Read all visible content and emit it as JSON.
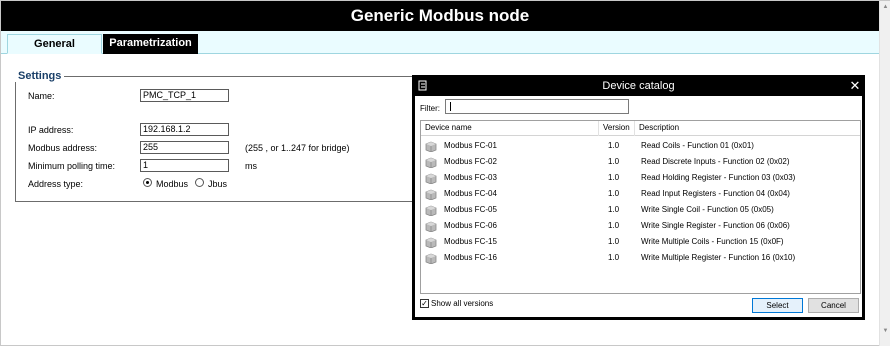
{
  "window": {
    "title": "Generic Modbus node"
  },
  "tabs": [
    {
      "label": "General"
    },
    {
      "label": "Parametrization"
    }
  ],
  "settings": {
    "legend": "Settings",
    "name_label": "Name:",
    "name_value": "PMC_TCP_1",
    "ip_label": "IP address:",
    "ip_value": "192.168.1.2",
    "modbus_label": "Modbus address:",
    "modbus_value": "255",
    "modbus_hint": "(255 , or 1..247 for bridge)",
    "polling_label": "Minimum polling time:",
    "polling_value": "1",
    "polling_unit": "ms",
    "addr_type_label": "Address type:",
    "addr_type_options": [
      "Modbus",
      "Jbus"
    ],
    "addr_type_selected": "Modbus"
  },
  "dialog": {
    "title": "Device catalog",
    "filter_label": "Filter:",
    "filter_value": "",
    "columns": [
      "Device name",
      "Version",
      "Description"
    ],
    "rows": [
      {
        "name": "Modbus FC-01",
        "version": "1.0",
        "description": "Read Coils - Function 01 (0x01)"
      },
      {
        "name": "Modbus FC-02",
        "version": "1.0",
        "description": "Read Discrete Inputs - Function 02 (0x02)"
      },
      {
        "name": "Modbus FC-03",
        "version": "1.0",
        "description": "Read Holding Register - Function 03 (0x03)"
      },
      {
        "name": "Modbus FC-04",
        "version": "1.0",
        "description": "Read Input Registers - Function 04 (0x04)"
      },
      {
        "name": "Modbus FC-05",
        "version": "1.0",
        "description": "Write Single Coil - Function 05 (0x05)"
      },
      {
        "name": "Modbus FC-06",
        "version": "1.0",
        "description": "Write Single Register - Function 06 (0x06)"
      },
      {
        "name": "Modbus FC-15",
        "version": "1.0",
        "description": "Write Multiple Coils - Function 15 (0x0F)"
      },
      {
        "name": "Modbus FC-16",
        "version": "1.0",
        "description": "Write Multiple Register - Function 16 (0x10)"
      }
    ],
    "show_all_versions_label": "Show all versions",
    "show_all_versions_checked": true,
    "select_label": "Select",
    "cancel_label": "Cancel"
  },
  "colors": {
    "title_bg": "#000000",
    "tab_active_bg": "#eafcff",
    "settings_legend": "#1a3f68",
    "select_button_border": "#0078d7"
  }
}
